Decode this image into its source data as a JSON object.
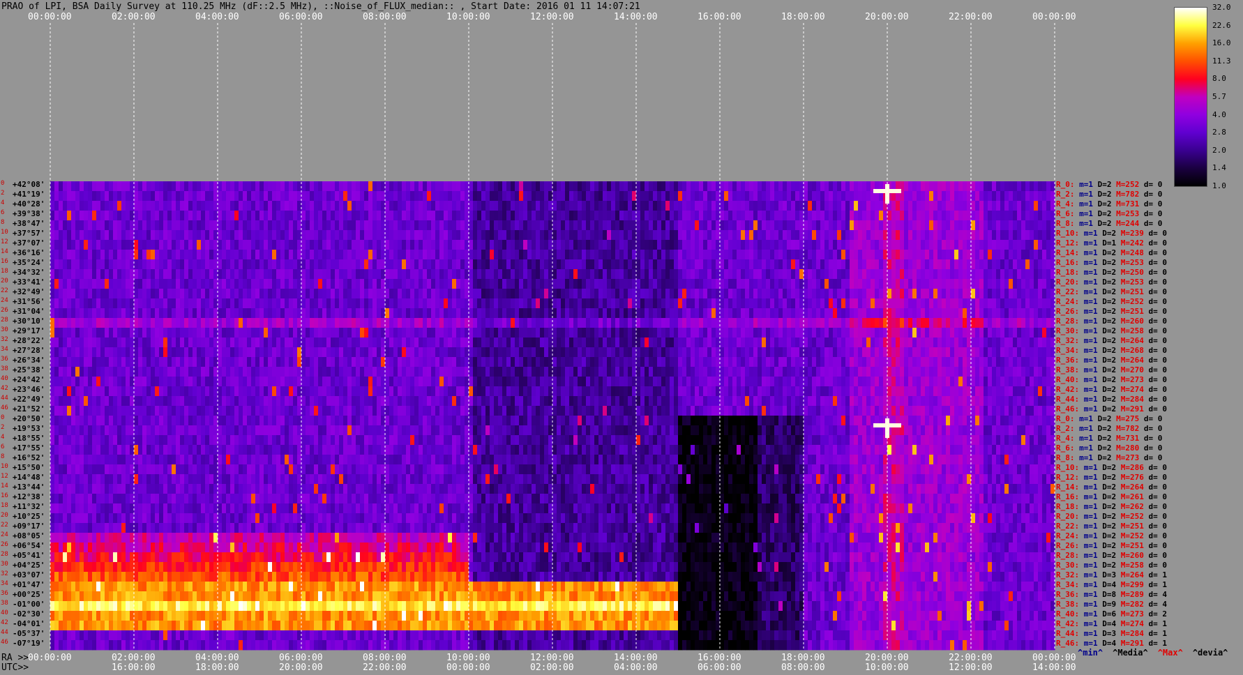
{
  "title": "PRAO of LPI, BSA Daily Survey at 110.25 MHz (dF::2.5 MHz), ::Noise_of_FLUX_median:: , Start Date: 2016 01 11 14:07:21",
  "chart_data": {
    "type": "heatmap",
    "x_top_ticks": [
      "00:00:00",
      "02:00:00",
      "04:00:00",
      "06:00:00",
      "08:00:00",
      "10:00:00",
      "12:00:00",
      "14:00:00",
      "16:00:00",
      "18:00:00",
      "20:00:00",
      "22:00:00",
      "00:00:00"
    ],
    "x_ra_ticks": [
      "00:00:00",
      "02:00:00",
      "04:00:00",
      "06:00:00",
      "08:00:00",
      "10:00:00",
      "12:00:00",
      "14:00:00",
      "16:00:00",
      "18:00:00",
      "20:00:00",
      "22:00:00",
      "00:00:00"
    ],
    "x_utc_ticks": [
      "16:00:00",
      "18:00:00",
      "20:00:00",
      "22:00:00",
      "00:00:00",
      "02:00:00",
      "04:00:00",
      "06:00:00",
      "08:00:00",
      "10:00:00",
      "12:00:00",
      "14:00:00"
    ],
    "ra_label": "RA >>",
    "utc_label": "UTC>>",
    "colorbar_ticks": [
      "32.0",
      "22.6",
      "16.0",
      "11.3",
      "8.0",
      "5.7",
      "4.0",
      "2.8",
      "2.0",
      "1.4",
      "1.0"
    ],
    "colorbar_scale": "log",
    "colorbar_range": [
      1.0,
      32.0
    ],
    "dec_labels": [
      "+42°08'",
      "+41°19'",
      "+40°28'",
      "+39°38'",
      "+38°47'",
      "+37°57'",
      "+37°07'",
      "+36°16'",
      "+35°24'",
      "+34°32'",
      "+33°41'",
      "+32°49'",
      "+31°56'",
      "+31°04'",
      "+30°10'",
      "+29°17'",
      "+28°22'",
      "+27°28'",
      "+26°34'",
      "+25°38'",
      "+24°42'",
      "+23°46'",
      "+22°49'",
      "+21°52'",
      "+20°50'",
      "+19°53'",
      "+18°55'",
      "+17°55'",
      "+16°52'",
      "+15°50'",
      "+14°48'",
      "+13°44'",
      "+12°38'",
      "+11°32'",
      "+10°25'",
      "+09°17'",
      "+08°05'",
      "+06°54'",
      "+05°41'",
      "+04°25'",
      "+03°07'",
      "+01°47'",
      "+00°25'",
      "-01°00'",
      "-02°30'",
      "-04°01'",
      "-05°37'",
      "-07°19'"
    ],
    "row_index_labels": [
      "0",
      "2",
      "4",
      "6",
      "8",
      "10",
      "12",
      "14",
      "16",
      "18",
      "20",
      "22",
      "24",
      "26",
      "28",
      "30",
      "32",
      "34",
      "36",
      "38",
      "40",
      "42",
      "44",
      "46",
      "0",
      "2",
      "4",
      "6",
      "8",
      "10",
      "12",
      "14",
      "16",
      "18",
      "20",
      "22",
      "24",
      "26",
      "28",
      "30",
      "32",
      "34",
      "36",
      "38",
      "40",
      "42",
      "44",
      "46"
    ],
    "row_stats": [
      {
        "r": "R_0:",
        "m": "m=1",
        "d": "D=2",
        "h": "M=252",
        "z": "d= 0"
      },
      {
        "r": "R_2:",
        "m": "m=1",
        "d": "D=2",
        "h": "M=782",
        "z": "d= 0"
      },
      {
        "r": "R_4:",
        "m": "m=1",
        "d": "D=2",
        "h": "M=731",
        "z": "d= 0"
      },
      {
        "r": "R_6:",
        "m": "m=1",
        "d": "D=2",
        "h": "M=253",
        "z": "d= 0"
      },
      {
        "r": "R_8:",
        "m": "m=1",
        "d": "D=2",
        "h": "M=244",
        "z": "d= 0"
      },
      {
        "r": "R_10:",
        "m": "m=1",
        "d": "D=2",
        "h": "M=239",
        "z": "d= 0"
      },
      {
        "r": "R_12:",
        "m": "m=1",
        "d": "D=1",
        "h": "M=242",
        "z": "d= 0"
      },
      {
        "r": "R_14:",
        "m": "m=1",
        "d": "D=2",
        "h": "M=248",
        "z": "d= 0"
      },
      {
        "r": "R_16:",
        "m": "m=1",
        "d": "D=2",
        "h": "M=253",
        "z": "d= 0"
      },
      {
        "r": "R_18:",
        "m": "m=1",
        "d": "D=2",
        "h": "M=250",
        "z": "d= 0"
      },
      {
        "r": "R_20:",
        "m": "m=1",
        "d": "D=2",
        "h": "M=253",
        "z": "d= 0"
      },
      {
        "r": "R_22:",
        "m": "m=1",
        "d": "D=2",
        "h": "M=251",
        "z": "d= 0"
      },
      {
        "r": "R_24:",
        "m": "m=1",
        "d": "D=2",
        "h": "M=252",
        "z": "d= 0"
      },
      {
        "r": "R_26:",
        "m": "m=1",
        "d": "D=2",
        "h": "M=251",
        "z": "d= 0"
      },
      {
        "r": "R_28:",
        "m": "m=1",
        "d": "D=2",
        "h": "M=260",
        "z": "d= 0"
      },
      {
        "r": "R_30:",
        "m": "m=1",
        "d": "D=2",
        "h": "M=258",
        "z": "d= 0"
      },
      {
        "r": "R_32:",
        "m": "m=1",
        "d": "D=2",
        "h": "M=264",
        "z": "d= 0"
      },
      {
        "r": "R_34:",
        "m": "m=1",
        "d": "D=2",
        "h": "M=268",
        "z": "d= 0"
      },
      {
        "r": "R_36:",
        "m": "m=1",
        "d": "D=2",
        "h": "M=264",
        "z": "d= 0"
      },
      {
        "r": "R_38:",
        "m": "m=1",
        "d": "D=2",
        "h": "M=270",
        "z": "d= 0"
      },
      {
        "r": "R_40:",
        "m": "m=1",
        "d": "D=2",
        "h": "M=273",
        "z": "d= 0"
      },
      {
        "r": "R_42:",
        "m": "m=1",
        "d": "D=2",
        "h": "M=274",
        "z": "d= 0"
      },
      {
        "r": "R_44:",
        "m": "m=1",
        "d": "D=2",
        "h": "M=284",
        "z": "d= 0"
      },
      {
        "r": "R_46:",
        "m": "m=1",
        "d": "D=2",
        "h": "M=291",
        "z": "d= 0"
      },
      {
        "r": "R_0:",
        "m": "m=1",
        "d": "D=2",
        "h": "M=275",
        "z": "d= 0"
      },
      {
        "r": "R_2:",
        "m": "m=1",
        "d": "D=2",
        "h": "M=782",
        "z": "d= 0"
      },
      {
        "r": "R_4:",
        "m": "m=1",
        "d": "D=2",
        "h": "M=731",
        "z": "d= 0"
      },
      {
        "r": "R_6:",
        "m": "m=1",
        "d": "D=2",
        "h": "M=280",
        "z": "d= 0"
      },
      {
        "r": "R_8:",
        "m": "m=1",
        "d": "D=2",
        "h": "M=273",
        "z": "d= 0"
      },
      {
        "r": "R_10:",
        "m": "m=1",
        "d": "D=2",
        "h": "M=286",
        "z": "d= 0"
      },
      {
        "r": "R_12:",
        "m": "m=1",
        "d": "D=2",
        "h": "M=276",
        "z": "d= 0"
      },
      {
        "r": "R_14:",
        "m": "m=1",
        "d": "D=2",
        "h": "M=264",
        "z": "d= 0"
      },
      {
        "r": "R_16:",
        "m": "m=1",
        "d": "D=2",
        "h": "M=261",
        "z": "d= 0"
      },
      {
        "r": "R_18:",
        "m": "m=1",
        "d": "D=2",
        "h": "M=262",
        "z": "d= 0"
      },
      {
        "r": "R_20:",
        "m": "m=1",
        "d": "D=2",
        "h": "M=252",
        "z": "d= 0"
      },
      {
        "r": "R_22:",
        "m": "m=1",
        "d": "D=2",
        "h": "M=251",
        "z": "d= 0"
      },
      {
        "r": "R_24:",
        "m": "m=1",
        "d": "D=2",
        "h": "M=252",
        "z": "d= 0"
      },
      {
        "r": "R_26:",
        "m": "m=1",
        "d": "D=2",
        "h": "M=251",
        "z": "d= 0"
      },
      {
        "r": "R_28:",
        "m": "m=1",
        "d": "D=2",
        "h": "M=260",
        "z": "d= 0"
      },
      {
        "r": "R_30:",
        "m": "m=1",
        "d": "D=2",
        "h": "M=258",
        "z": "d= 0"
      },
      {
        "r": "R_32:",
        "m": "m=1",
        "d": "D=3",
        "h": "M=264",
        "z": "d= 1"
      },
      {
        "r": "R_34:",
        "m": "m=1",
        "d": "D=4",
        "h": "M=299",
        "z": "d= 1"
      },
      {
        "r": "R_36:",
        "m": "m=1",
        "d": "D=8",
        "h": "M=289",
        "z": "d= 4"
      },
      {
        "r": "R_38:",
        "m": "m=1",
        "d": "D=9",
        "h": "M=282",
        "z": "d= 4"
      },
      {
        "r": "R_40:",
        "m": "m=1",
        "d": "D=6",
        "h": "M=273",
        "z": "d= 2"
      },
      {
        "r": "R_42:",
        "m": "m=1",
        "d": "D=4",
        "h": "M=274",
        "z": "d= 1"
      },
      {
        "r": "R_44:",
        "m": "m=1",
        "d": "D=3",
        "h": "M=284",
        "z": "d= 1"
      },
      {
        "r": "R_46:",
        "m": "m=1",
        "d": "D=4",
        "h": "M=291",
        "z": "d= 1"
      }
    ],
    "legend": [
      {
        "text": "^min^",
        "color": "#00008a"
      },
      {
        "text": "^Media^",
        "color": "#000000"
      },
      {
        "text": "^Max^",
        "color": "#e00000"
      },
      {
        "text": "^devia^",
        "color": "#000000"
      }
    ]
  }
}
